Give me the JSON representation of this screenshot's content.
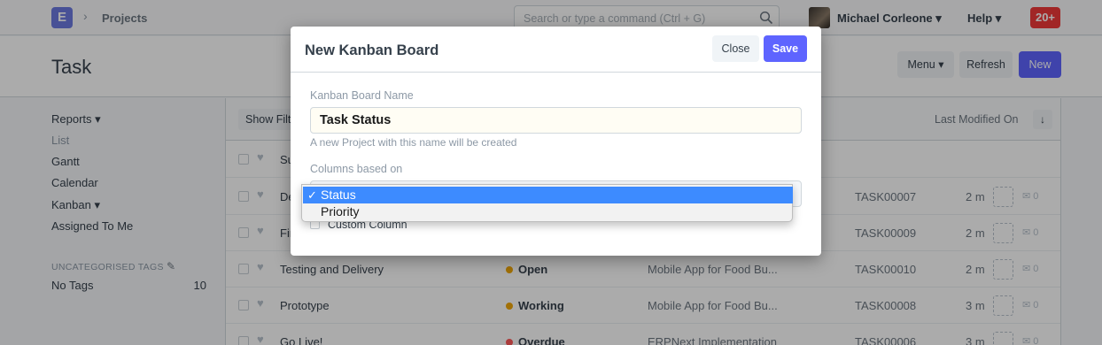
{
  "navbar": {
    "logo_letter": "E",
    "breadcrumb": "Projects",
    "search_placeholder": "Search or type a command (Ctrl + G)",
    "user_name": "Michael Corleone",
    "help_label": "Help",
    "notifications": "20+"
  },
  "page": {
    "title": "Task",
    "menu_label": "Menu",
    "refresh_label": "Refresh",
    "new_label": "New"
  },
  "sidebar": {
    "items": [
      "Reports",
      "List",
      "Gantt",
      "Calendar",
      "Kanban",
      "Assigned To Me"
    ],
    "tags_heading": "UNCATEGORISED TAGS",
    "no_tags_label": "No Tags",
    "no_tags_count": "10"
  },
  "list": {
    "filter_label": "Show Filters",
    "sort_label": "Last Modified On",
    "subject_header": "Subject",
    "rows": [
      {
        "subject": "De",
        "status": "",
        "project": "",
        "id": "TASK00007",
        "age": "2 m",
        "comments": "0"
      },
      {
        "subject": "Fir",
        "status": "",
        "project": "",
        "id": "TASK00009",
        "age": "2 m",
        "comments": "0"
      },
      {
        "subject": "Testing and Delivery",
        "status": "Open",
        "project": "Mobile App for Food Bu...",
        "id": "TASK00010",
        "age": "2 m",
        "comments": "0"
      },
      {
        "subject": "Prototype",
        "status": "Working",
        "project": "Mobile App for Food Bu...",
        "id": "TASK00008",
        "age": "3 m",
        "comments": "0"
      },
      {
        "subject": "Go Live!",
        "status": "Overdue",
        "project": "ERPNext Implementation",
        "id": "TASK00006",
        "age": "3 m",
        "comments": "0"
      }
    ]
  },
  "modal": {
    "title": "New Kanban Board",
    "close_label": "Close",
    "save_label": "Save",
    "name_label": "Kanban Board Name",
    "name_value": "Task Status",
    "name_help": "A new Project with this name will be created",
    "columns_label": "Columns based on",
    "custom_column_label": "Custom Column",
    "dropdown_options": [
      "Status",
      "Priority"
    ],
    "selected_option": "Status"
  },
  "colors": {
    "primary": "#5e64ff",
    "open": "#f0a70a",
    "working": "#f0a70a",
    "overdue": "#ff5858",
    "notification": "#f13a3a",
    "selection": "#3d8bff"
  }
}
